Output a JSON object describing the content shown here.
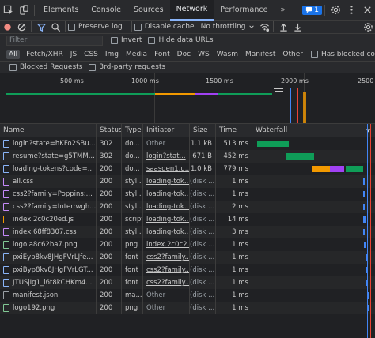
{
  "tabs": {
    "items": [
      "Elements",
      "Console",
      "Sources",
      "Network",
      "Performance"
    ],
    "active": "Network",
    "more": "»",
    "issues_count": "1"
  },
  "toolbar": {
    "preserve_log": "Preserve log",
    "disable_cache": "Disable cache",
    "throttling": "No throttling"
  },
  "filter": {
    "placeholder": "Filter",
    "value": "",
    "invert": "Invert",
    "hide_data_urls": "Hide data URLs"
  },
  "types": {
    "items": [
      "All",
      "Fetch/XHR",
      "JS",
      "CSS",
      "Img",
      "Media",
      "Font",
      "Doc",
      "WS",
      "Wasm",
      "Manifest",
      "Other"
    ],
    "active": "All",
    "has_blocked_cookies": "Has blocked cookies",
    "blocked_requests": "Blocked Requests",
    "third_party": "3rd-party requests"
  },
  "overview": {
    "ticks": [
      "500 ms",
      "1000 ms",
      "1500 ms",
      "2000 ms",
      "2500"
    ]
  },
  "columns": {
    "name": "Name",
    "status": "Status",
    "type": "Type",
    "initiator": "Initiator",
    "size": "Size",
    "time": "Time",
    "waterfall": "Waterfall"
  },
  "requests": [
    {
      "name": "login?state=hKFo2SBu...",
      "status": "302",
      "type": "do...",
      "initiator": "Other",
      "initiator_link": false,
      "size": "1.1 kB",
      "time": "513 ms",
      "kind": "doc"
    },
    {
      "name": "resume?state=g5TMM...",
      "status": "302",
      "type": "do...",
      "initiator": "login?stat...",
      "initiator_link": true,
      "size": "671 B",
      "time": "452 ms",
      "kind": "doc"
    },
    {
      "name": "loading-tokens?code=...",
      "status": "200",
      "type": "do...",
      "initiator": "saasden1.u...",
      "initiator_link": true,
      "size": "1.0 kB",
      "time": "779 ms",
      "kind": "doc"
    },
    {
      "name": "all.css",
      "status": "200",
      "type": "styl...",
      "initiator": "loading-tok...",
      "initiator_link": true,
      "size": "(disk ...",
      "time": "1 ms",
      "kind": "style"
    },
    {
      "name": "css2?family=Poppins:...",
      "status": "200",
      "type": "styl...",
      "initiator": "loading-tok...",
      "initiator_link": true,
      "size": "(disk ...",
      "time": "1 ms",
      "kind": "style"
    },
    {
      "name": "css2?family=Inter:wgh...",
      "status": "200",
      "type": "styl...",
      "initiator": "loading-tok...",
      "initiator_link": true,
      "size": "(disk ...",
      "time": "2 ms",
      "kind": "style"
    },
    {
      "name": "index.2c0c20ed.js",
      "status": "200",
      "type": "script",
      "initiator": "loading-tok...",
      "initiator_link": true,
      "size": "(disk ...",
      "time": "14 ms",
      "kind": "script"
    },
    {
      "name": "index.68ff8307.css",
      "status": "200",
      "type": "styl...",
      "initiator": "loading-tok...",
      "initiator_link": true,
      "size": "(disk ...",
      "time": "3 ms",
      "kind": "style"
    },
    {
      "name": "logo.a8c62ba7.png",
      "status": "200",
      "type": "png",
      "initiator": "index.2c0c2...",
      "initiator_link": true,
      "size": "(disk ...",
      "time": "1 ms",
      "kind": "img"
    },
    {
      "name": "pxiEyp8kv8JHgFVrLJfe...",
      "status": "200",
      "type": "font",
      "initiator": "css2?family...",
      "initiator_link": true,
      "size": "(disk ...",
      "time": "1 ms",
      "kind": "font"
    },
    {
      "name": "pxiByp8kv8JHgFVrLGT...",
      "status": "200",
      "type": "font",
      "initiator": "css2?family...",
      "initiator_link": true,
      "size": "(disk ...",
      "time": "1 ms",
      "kind": "font"
    },
    {
      "name": "JTUSjIg1_i6t8kCHKm4...",
      "status": "200",
      "type": "font",
      "initiator": "css2?family...",
      "initiator_link": true,
      "size": "(disk ...",
      "time": "1 ms",
      "kind": "font"
    },
    {
      "name": "manifest.json",
      "status": "200",
      "type": "ma...",
      "initiator": "Other",
      "initiator_link": false,
      "size": "(disk ...",
      "time": "1 ms",
      "kind": "other"
    },
    {
      "name": "logo192.png",
      "status": "200",
      "type": "png",
      "initiator": "Other",
      "initiator_link": false,
      "size": "(disk ...",
      "time": "1 ms",
      "kind": "img"
    }
  ],
  "colors": {
    "accent": "#8ab4f8",
    "record_red": "#f28b82",
    "wf_green": "#0f9d58",
    "wf_orange": "#f29900",
    "wf_purple": "#a142f4",
    "dom_blue": "#4285f4",
    "load_red": "#ea4335"
  }
}
